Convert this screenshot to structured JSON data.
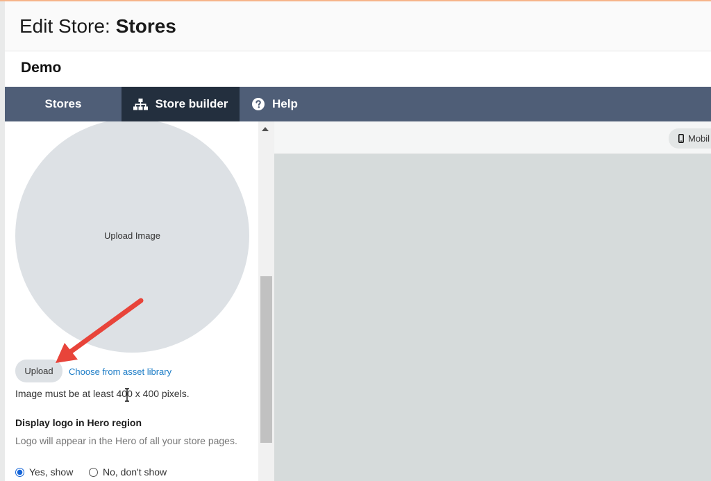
{
  "header": {
    "title_prefix": "Edit Store:",
    "title_name": "Stores"
  },
  "subheader": {
    "store_name": "Demo"
  },
  "nav": {
    "items": [
      {
        "label": "Stores",
        "icon": "none",
        "active": false
      },
      {
        "label": "Store builder",
        "icon": "sitemap-icon",
        "active": true
      },
      {
        "label": "Help",
        "icon": "question-circle-icon",
        "active": false
      }
    ]
  },
  "logo_panel": {
    "upload_image_label": "Upload Image",
    "upload_button": "Upload",
    "asset_library_link": "Choose from asset library",
    "image_requirement": "Image must be at least 400 x 400 pixels.",
    "display_logo_heading": "Display logo in Hero region",
    "display_logo_description": "Logo will appear in the Hero of all your store pages.",
    "radio_yes": "Yes, show",
    "radio_no": "No, don't show",
    "selected_option": "Yes, show"
  },
  "preview": {
    "device_toggle_label": "Mobil"
  },
  "colors": {
    "nav_bg": "#4f5e77",
    "nav_active_bg": "#232f3e",
    "link": "#1a7bc6",
    "annotation_arrow": "#e8443a",
    "canvas_bg": "#d6dbdb"
  }
}
